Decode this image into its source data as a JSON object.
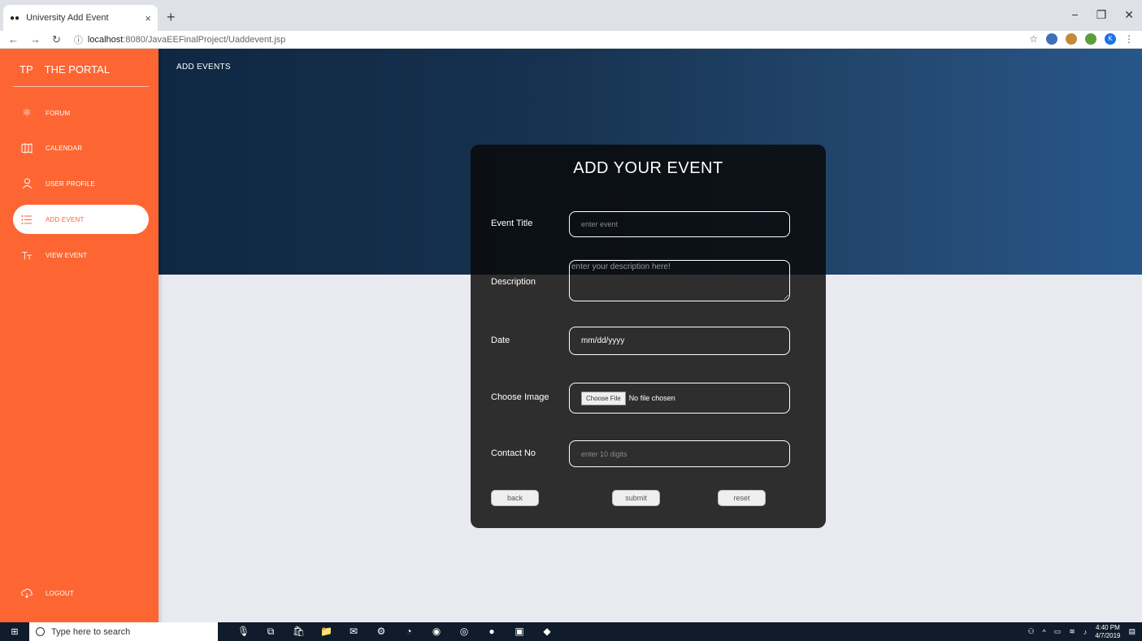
{
  "browser": {
    "tab_title": "University Add Event",
    "tab_close": "×",
    "new_tab": "+",
    "url_host": "localhost",
    "url_path": ":8080/JavaEEFinalProject/Uaddevent.jsp",
    "profile_initial": "K"
  },
  "sidebar": {
    "logo_abbr": "TP",
    "logo_text": "THE PORTAL",
    "items": [
      {
        "label": "FORUM",
        "icon": "atom-icon",
        "active": false
      },
      {
        "label": "CALENDAR",
        "icon": "map-icon",
        "active": false
      },
      {
        "label": "USER PROFILE",
        "icon": "user-icon",
        "active": false
      },
      {
        "label": "ADD EVENT",
        "icon": "list-icon",
        "active": true
      },
      {
        "label": "VIEW EVENT",
        "icon": "text-icon",
        "active": false
      }
    ],
    "logout_label": "LOGOUT"
  },
  "header": {
    "title": "ADD EVENTS"
  },
  "form": {
    "title": "ADD YOUR EVENT",
    "event_title_label": "Event Title",
    "event_title_placeholder": "enter event",
    "description_label": "Description",
    "description_placeholder": "enter your description here!",
    "date_label": "Date",
    "date_value": "mm/dd/yyyy",
    "image_label": "Choose Image",
    "file_button": "Choose File",
    "file_status": "No file chosen",
    "contact_label": "Contact No",
    "contact_placeholder": "enter 10 digits",
    "back_label": "back",
    "submit_label": "submit",
    "reset_label": "reset"
  },
  "taskbar": {
    "search_placeholder": "Type here to search",
    "time": "4:40 PM",
    "date": "4/7/2019"
  }
}
